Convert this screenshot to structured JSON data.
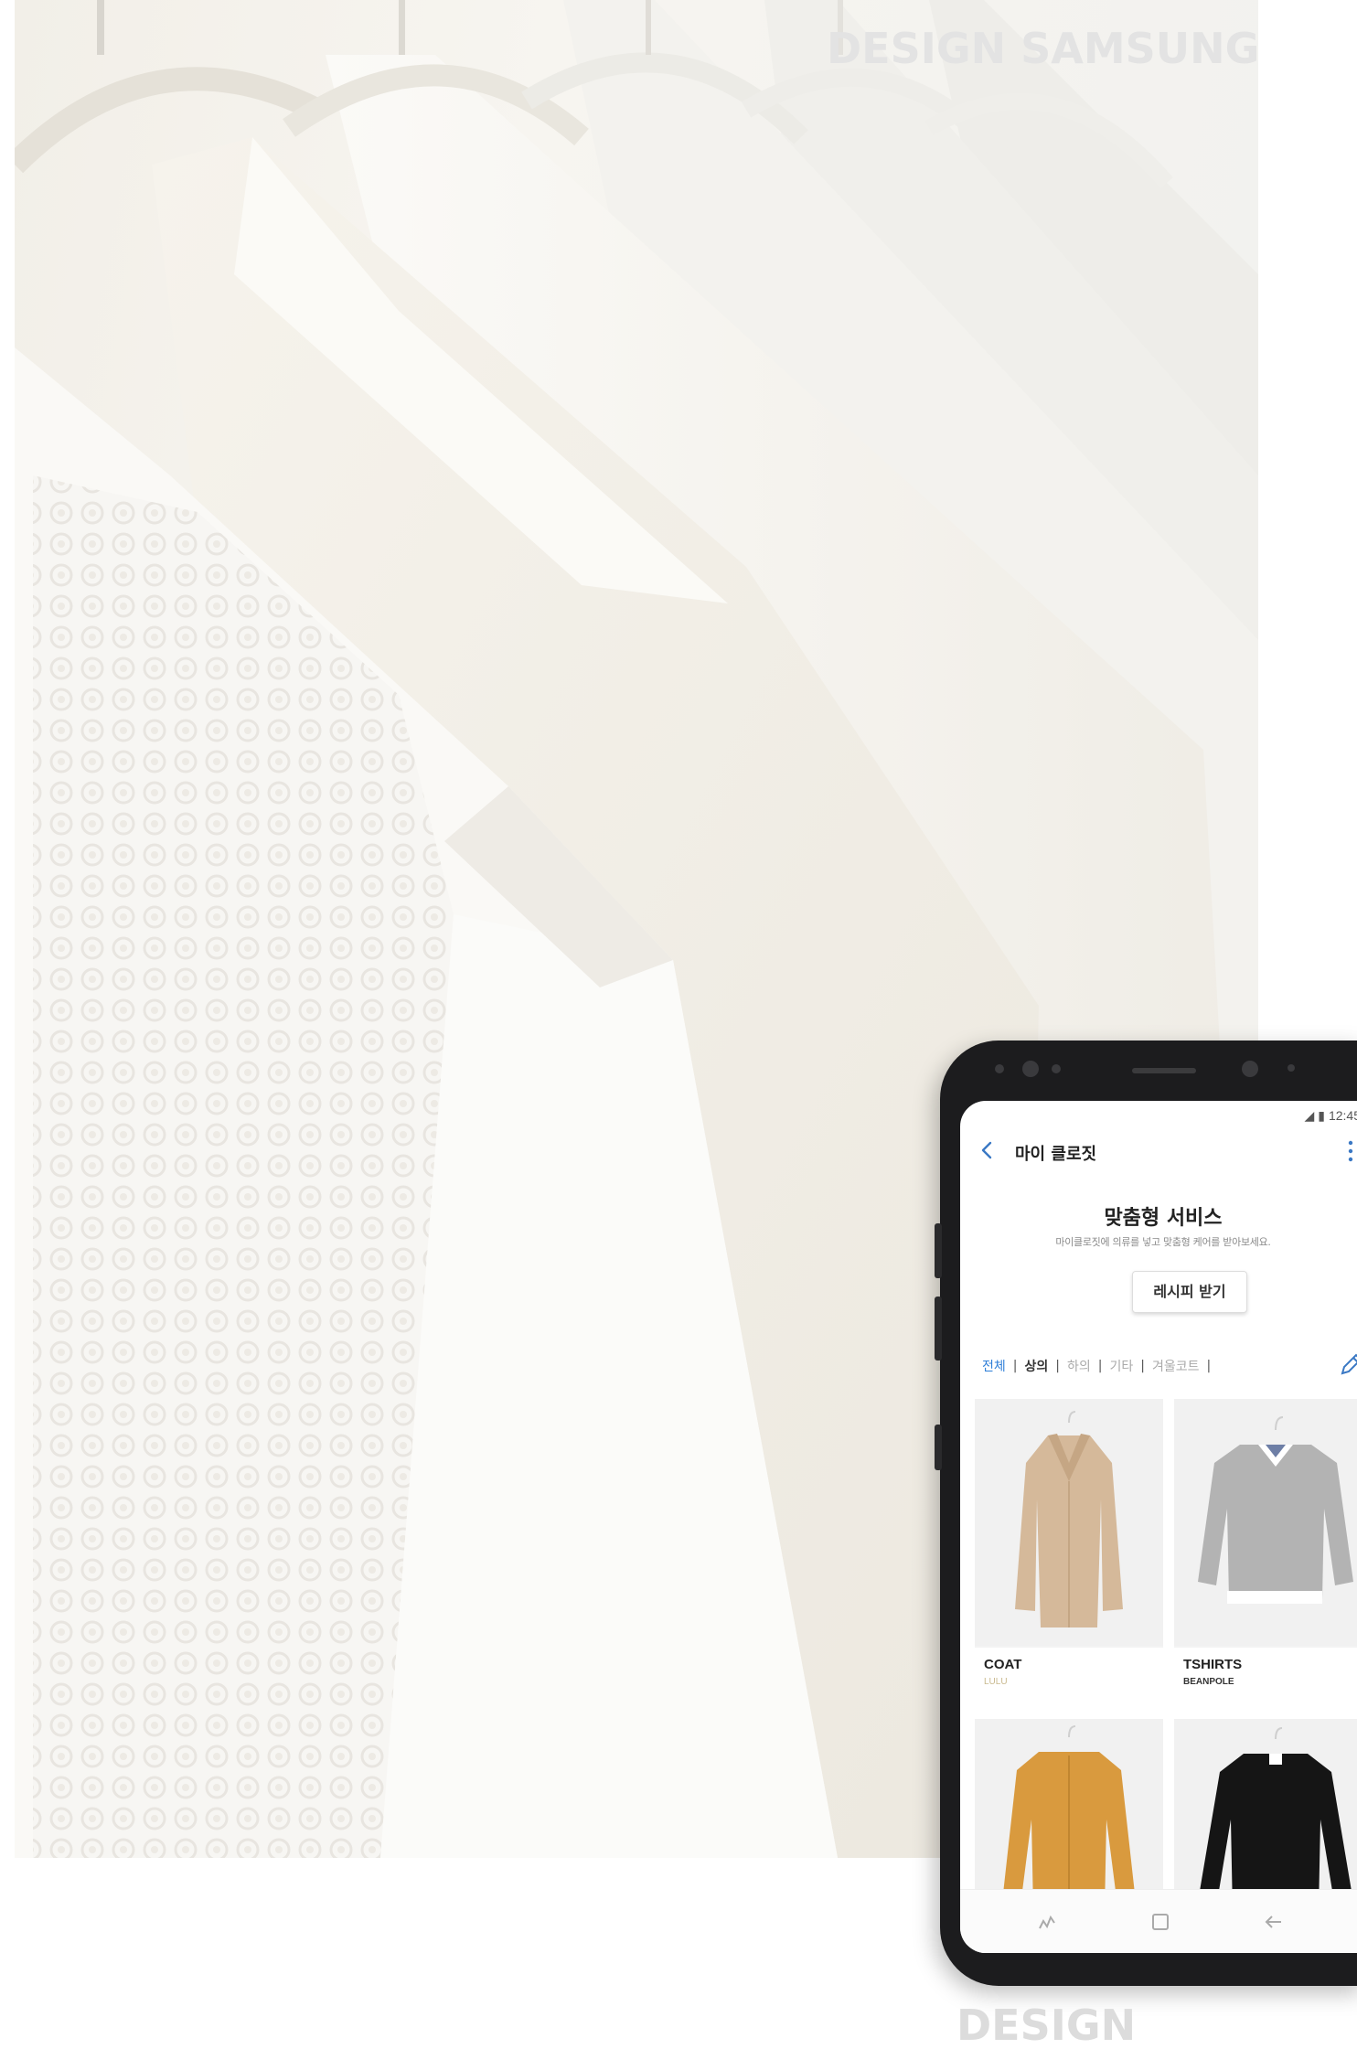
{
  "watermarks": {
    "top": "DESIGN SAMSUNG",
    "bottom": "DESIGN SAMSUNG"
  },
  "status_bar": {
    "time": "12:45"
  },
  "app_bar": {
    "title": "마이 클로짓",
    "back_icon": "chevron-left-icon",
    "more_icon": "more-vertical-icon"
  },
  "promo": {
    "title": "맞춤형 서비스",
    "description": "마이클로짓에 의류를 넣고 맞춤형 케어를 받아보세요.",
    "button_label": "레시피 받기"
  },
  "tabs": [
    {
      "label": "전체",
      "state": "active"
    },
    {
      "label": "상의",
      "state": "bold"
    },
    {
      "label": "하의",
      "state": "normal"
    },
    {
      "label": "기타",
      "state": "normal"
    },
    {
      "label": "겨울코트",
      "state": "normal"
    }
  ],
  "edit_icon": "pencil-icon",
  "items": [
    {
      "name": "COAT",
      "brand": "LULU",
      "image": "beige-coat",
      "color": "#d5b99a"
    },
    {
      "name": "TSHIRTS",
      "brand": "BEANPOLE",
      "image": "grey-sweatshirt",
      "color": "#b3b3b3"
    },
    {
      "name": "",
      "brand": "",
      "image": "mustard-cardigan",
      "color": "#d99a3e"
    },
    {
      "name": "",
      "brand": "",
      "image": "black-cardigan",
      "color": "#151515"
    }
  ],
  "nav_icons": [
    "recent-apps-icon",
    "home-icon",
    "back-arrow-icon"
  ]
}
